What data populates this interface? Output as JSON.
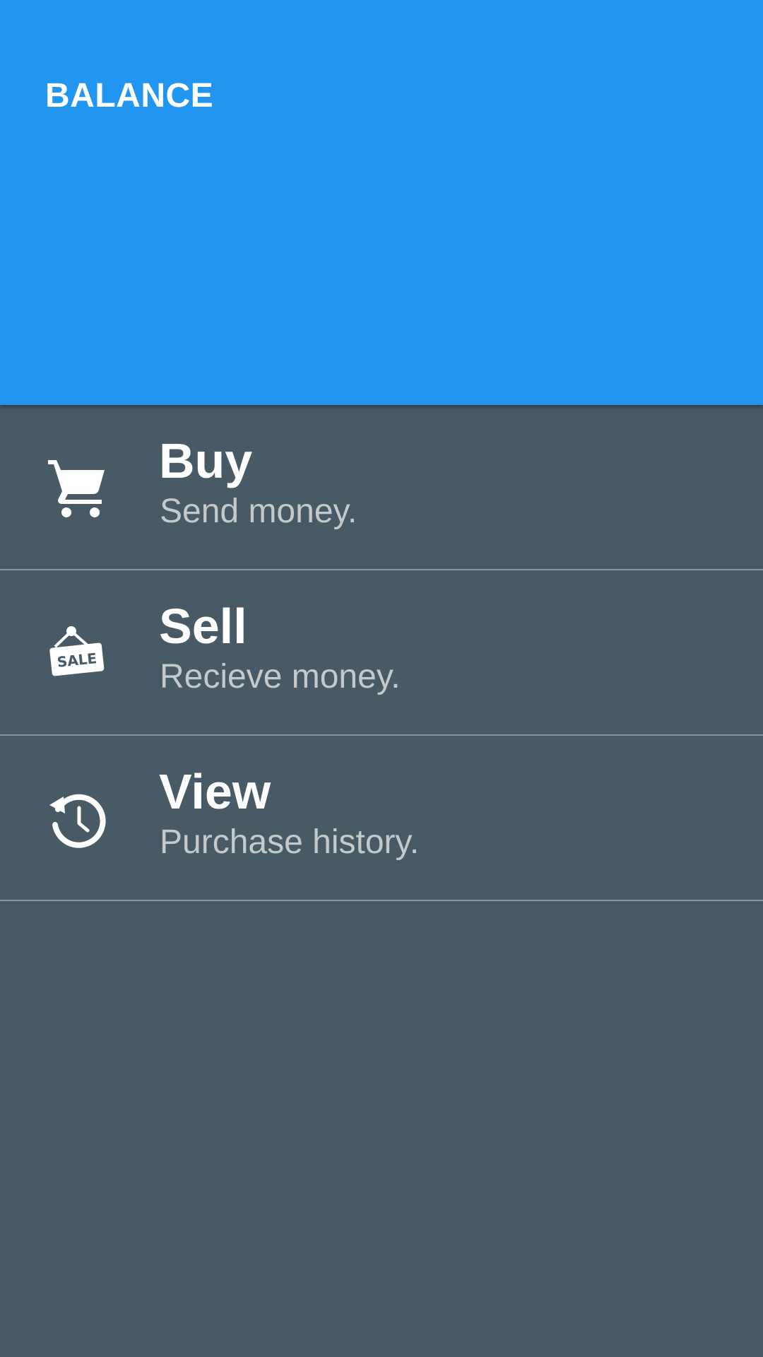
{
  "header": {
    "title": "BALANCE"
  },
  "colors": {
    "header_bg": "#2196f0",
    "body_bg": "#475a65",
    "divider": "#8a9aa3",
    "title_text": "#ffffff",
    "subtitle_text": "#c4c9cc"
  },
  "menu": {
    "items": [
      {
        "title": "Buy",
        "subtitle": "Send money.",
        "icon": "shopping-cart-icon"
      },
      {
        "title": "Sell",
        "subtitle": "Recieve money.",
        "icon": "sale-tag-icon",
        "icon_text": "SALE"
      },
      {
        "title": "View",
        "subtitle": "Purchase history.",
        "icon": "history-icon"
      }
    ]
  }
}
